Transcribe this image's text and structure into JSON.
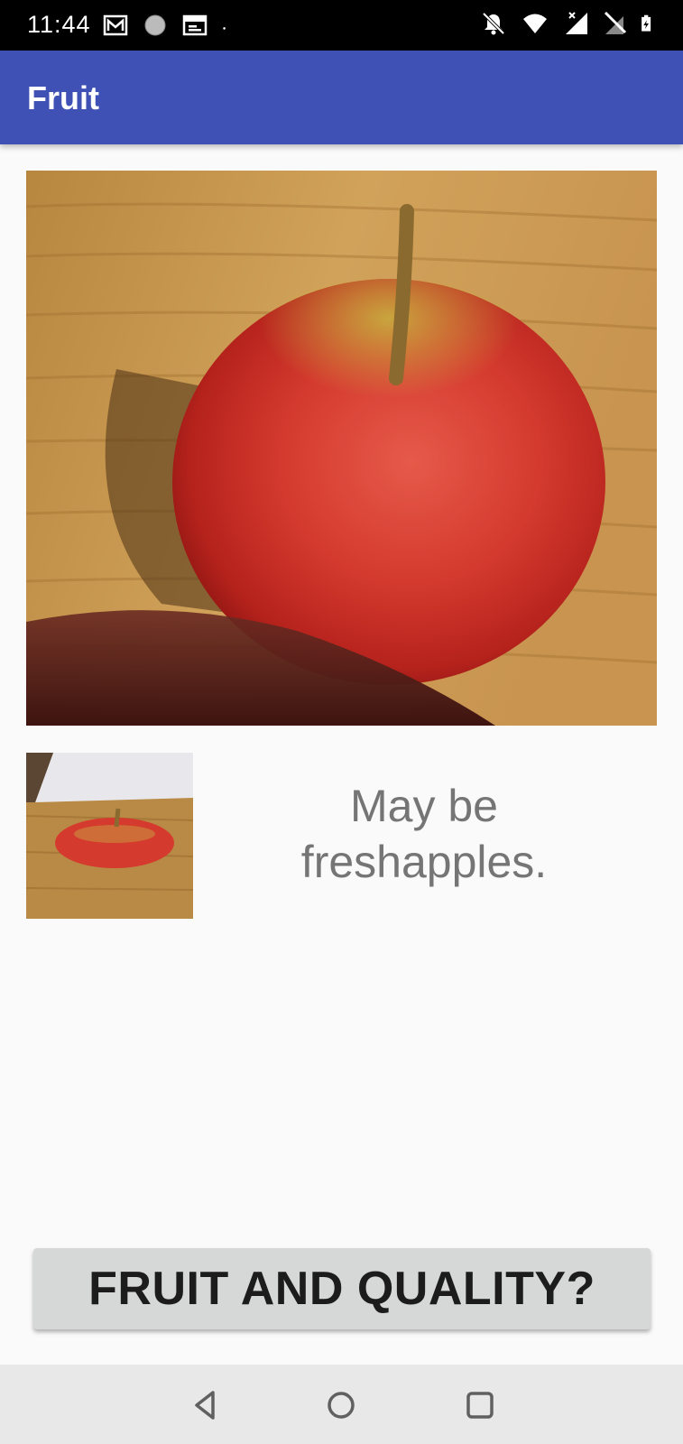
{
  "status_bar": {
    "time": "11:44",
    "left_icons": [
      "gmail-icon",
      "circle-app-icon",
      "calendar-icon",
      "dot-icon"
    ],
    "right_icons": [
      "notifications-off-icon",
      "wifi-icon",
      "signal-icon",
      "no-sim-icon",
      "battery-charging-icon"
    ]
  },
  "app_bar": {
    "title": "Fruit"
  },
  "main": {
    "result_text": "May be freshapples."
  },
  "action_button": {
    "label": "FRUIT AND QUALITY?"
  },
  "nav_bar": {
    "buttons": [
      "back-icon",
      "home-icon",
      "recents-icon"
    ]
  },
  "colors": {
    "app_bar": "#3f51b5",
    "status_bar": "#000000",
    "button": "#d6d7d7",
    "result_text": "#757575"
  }
}
